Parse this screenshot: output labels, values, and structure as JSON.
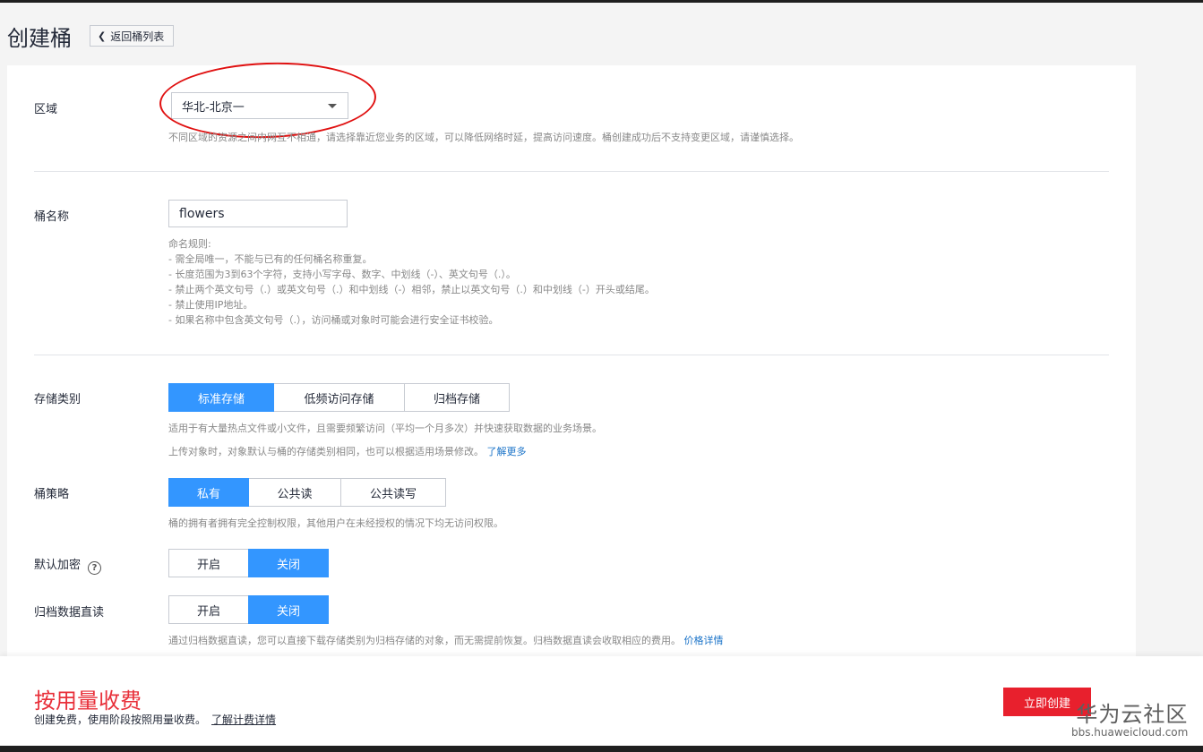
{
  "page": {
    "title": "创建桶",
    "back_label": "返回桶列表"
  },
  "region": {
    "label": "区域",
    "selected": "华北-北京一",
    "hint": "不同区域的资源之间内网互不相通，请选择靠近您业务的区域，可以降低网络时延，提高访问速度。桶创建成功后不支持变更区域，请谨慎选择。"
  },
  "bucket_name": {
    "label": "桶名称",
    "value": "flowers",
    "rules": [
      "命名规则:",
      "- 需全局唯一，不能与已有的任何桶名称重复。",
      "- 长度范围为3到63个字符，支持小写字母、数字、中划线（-）、英文句号（.）。",
      "- 禁止两个英文句号（.）或英文句号（.）和中划线（-）相邻，禁止以英文句号（.）和中划线（-）开头或结尾。",
      "- 禁止使用IP地址。",
      "- 如果名称中包含英文句号（.），访问桶或对象时可能会进行安全证书校验。"
    ]
  },
  "storage_class": {
    "label": "存储类别",
    "options": [
      "标准存储",
      "低频访问存储",
      "归档存储"
    ],
    "selected_index": 0,
    "hint1": "适用于有大量热点文件或小文件，且需要频繁访问（平均一个月多次）并快速获取数据的业务场景。",
    "hint2": "上传对象时，对象默认与桶的存储类别相同，也可以根据适用场景修改。",
    "learn_more": "了解更多"
  },
  "bucket_policy": {
    "label": "桶策略",
    "options": [
      "私有",
      "公共读",
      "公共读写"
    ],
    "selected_index": 0,
    "hint": "桶的拥有者拥有完全控制权限，其他用户在未经授权的情况下均无访问权限。"
  },
  "encryption": {
    "label": "默认加密",
    "help": "?",
    "options": [
      "开启",
      "关闭"
    ],
    "selected_index": 1
  },
  "archive_direct_read": {
    "label": "归档数据直读",
    "options": [
      "开启",
      "关闭"
    ],
    "selected_index": 1,
    "hint": "通过归档数据直读，您可以直接下载存储类别为归档存储的对象，而无需提前恢复。归档数据直读会收取相应的费用。",
    "price_link": "价格详情"
  },
  "footer": {
    "billing_title": "按用量收费",
    "billing_sub": "创建免费，使用阶段按照用量收费。",
    "billing_link": "了解计费详情",
    "create_label": "立即创建"
  },
  "watermark": {
    "text": "华为云社区",
    "url": "bbs.huaweicloud.com"
  },
  "colors": {
    "primary": "#3396ff",
    "danger": "#e8202d",
    "link": "#1a73c8",
    "annotation": "#e01010"
  }
}
